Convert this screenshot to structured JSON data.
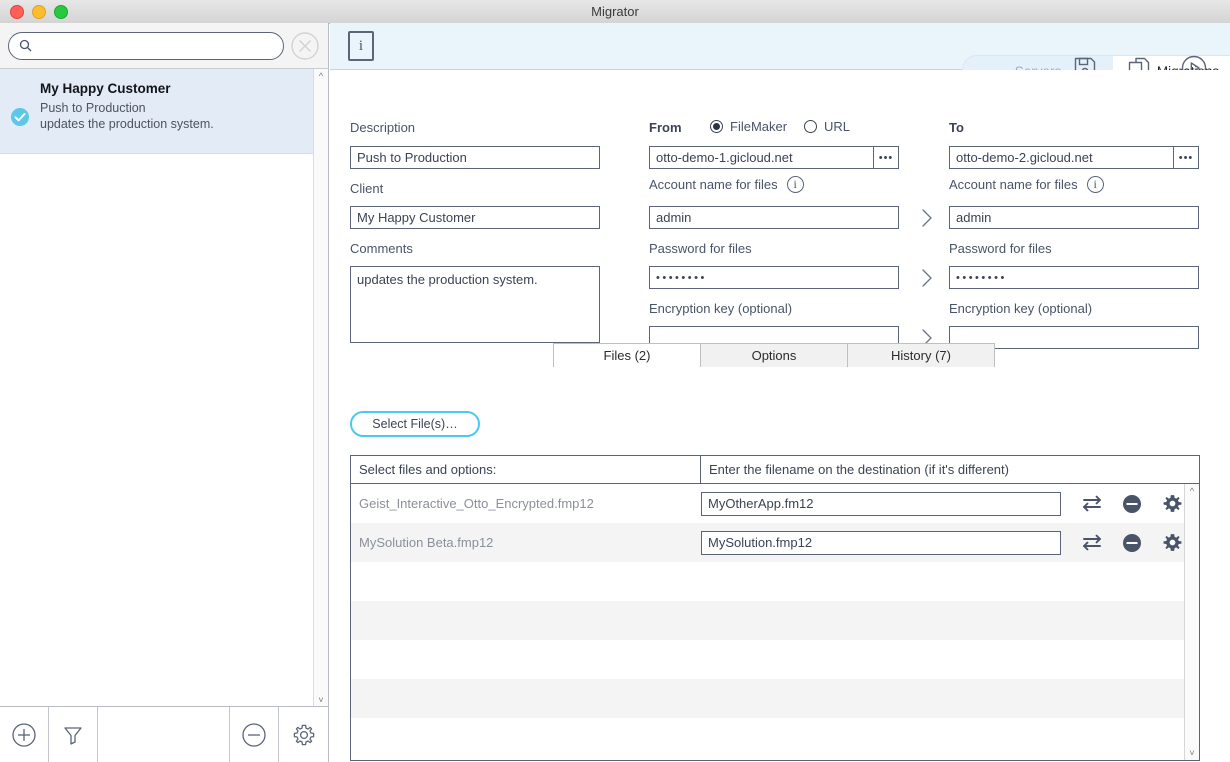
{
  "window": {
    "title": "Migrator",
    "traffic_lights": [
      "close",
      "minimize",
      "zoom"
    ]
  },
  "sidebar": {
    "search": {
      "value": "",
      "placeholder": ""
    },
    "items": [
      {
        "title": "My Happy Customer",
        "line1": "Push to Production",
        "line2": "updates the production system.",
        "status": "enabled"
      }
    ],
    "toolbar": [
      {
        "name": "add-migration-button",
        "icon": "plus-circle-icon"
      },
      {
        "name": "filter-button",
        "icon": "filter-icon"
      },
      {
        "name": "remove-migration-button",
        "icon": "minus-circle-icon"
      },
      {
        "name": "settings-button",
        "icon": "gear-icon"
      }
    ]
  },
  "toolbar": {
    "info_label": "i",
    "segments": [
      {
        "label": "Servers",
        "active": false
      },
      {
        "label": "Migrations",
        "active": true
      }
    ],
    "actions": [
      {
        "name": "save-button",
        "icon": "save-disk-icon"
      },
      {
        "name": "duplicate-button",
        "icon": "copy-pages-icon"
      },
      {
        "name": "run-button",
        "icon": "play-circle-icon"
      }
    ]
  },
  "form": {
    "description_label": "Description",
    "description_value": "Push to Production",
    "client_label": "Client",
    "client_value": "My Happy Customer",
    "comments_label": "Comments",
    "comments_value": "updates the production system.",
    "from": {
      "heading": "From",
      "source_options": [
        {
          "label": "FileMaker",
          "selected": true
        },
        {
          "label": "URL",
          "selected": false
        }
      ],
      "host_value": "otto-demo-1.gicloud.net",
      "more_button_label": "•••",
      "account_label": "Account name for files",
      "account_value": "admin",
      "password_label": "Password for files",
      "password_value": "••••••••",
      "encryption_label": "Encryption key (optional)",
      "encryption_value": ""
    },
    "to": {
      "heading": "To",
      "host_value": "otto-demo-2.gicloud.net",
      "more_button_label": "•••",
      "account_label": "Account name for files",
      "account_value": "admin",
      "password_label": "Password for files",
      "password_value": "••••••••",
      "encryption_label": "Encryption key (optional)",
      "encryption_value": ""
    }
  },
  "tabs": [
    {
      "label": "Files (2)",
      "active": true
    },
    {
      "label": "Options",
      "active": false
    },
    {
      "label": "History (7)",
      "active": false
    }
  ],
  "files_pane": {
    "select_files_button": "Select File(s)…",
    "columns": {
      "source": "Select files and options:",
      "destination": "Enter the filename on the destination (if it's different)"
    },
    "rows": [
      {
        "source": "Geist_Interactive_Otto_Encrypted.fmp12",
        "destination": "MyOtherApp.fm12"
      },
      {
        "source": "MySolution Beta.fmp12",
        "destination": "MySolution.fmp12"
      }
    ],
    "row_actions": [
      {
        "name": "swap-icon"
      },
      {
        "name": "remove-icon"
      },
      {
        "name": "gear-icon"
      }
    ]
  },
  "colors": {
    "accent_cyan": "#4cc8ef",
    "toolbar_blue": "#e9f4fb",
    "selected_row": "#e3ebf7",
    "ink": "#4a5468"
  }
}
